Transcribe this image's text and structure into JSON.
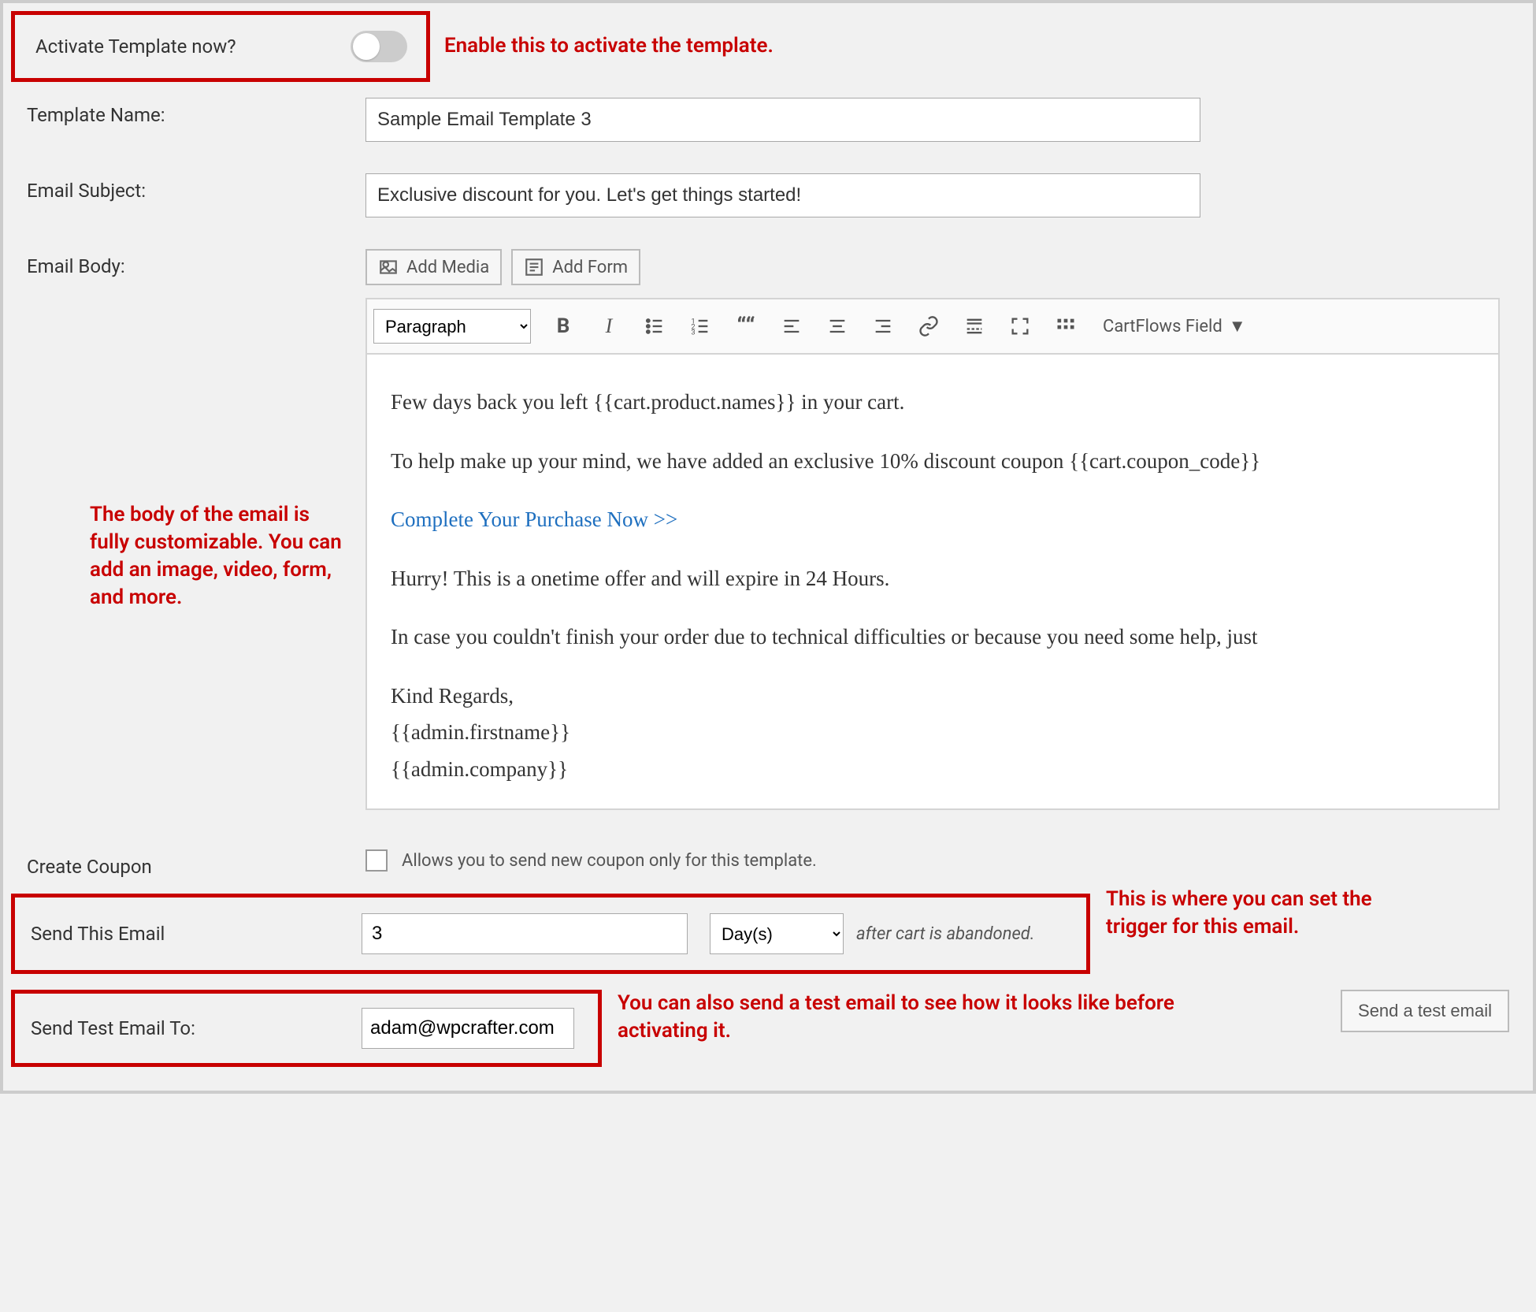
{
  "activate": {
    "label": "Activate Template now?",
    "annotation": "Enable this to activate the template."
  },
  "template_name": {
    "label": "Template Name:",
    "value": "Sample Email Template 3"
  },
  "email_subject": {
    "label": "Email Subject:",
    "value": "Exclusive discount for you. Let's get things started!"
  },
  "email_body": {
    "label": "Email Body:",
    "add_media": "Add Media",
    "add_form": "Add Form",
    "format": "Paragraph",
    "cartflows_field": "CartFlows Field",
    "lines": {
      "l1": "Few days back you left {{cart.product.names}} in your cart.",
      "l2": "To help make up your mind, we have added an exclusive 10% discount coupon {{cart.coupon_code}}",
      "l3": "Complete Your Purchase Now >>",
      "l4": "Hurry! This is a onetime offer and will expire in 24 Hours.",
      "l5": "In case you couldn't finish your order due to technical difficulties or because you need some help, just",
      "l6": "Kind Regards,",
      "l7": "{{admin.firstname}}",
      "l8": "{{admin.company}}"
    },
    "annotation": "The body of the email is fully customizable. You can add an image, video, form, and more."
  },
  "create_coupon": {
    "label": "Create Coupon",
    "desc": "Allows you to send new coupon only for this template."
  },
  "send_email": {
    "label": "Send This Email",
    "value": "3",
    "unit": "Day(s)",
    "suffix": "after cart is abandoned.",
    "annotation": "This is where you can set the trigger for this email."
  },
  "send_test": {
    "label": "Send Test Email To:",
    "value": "adam@wpcrafter.com",
    "button": "Send a test email",
    "annotation": "You can also send a test email to see how it looks like before activating it."
  }
}
